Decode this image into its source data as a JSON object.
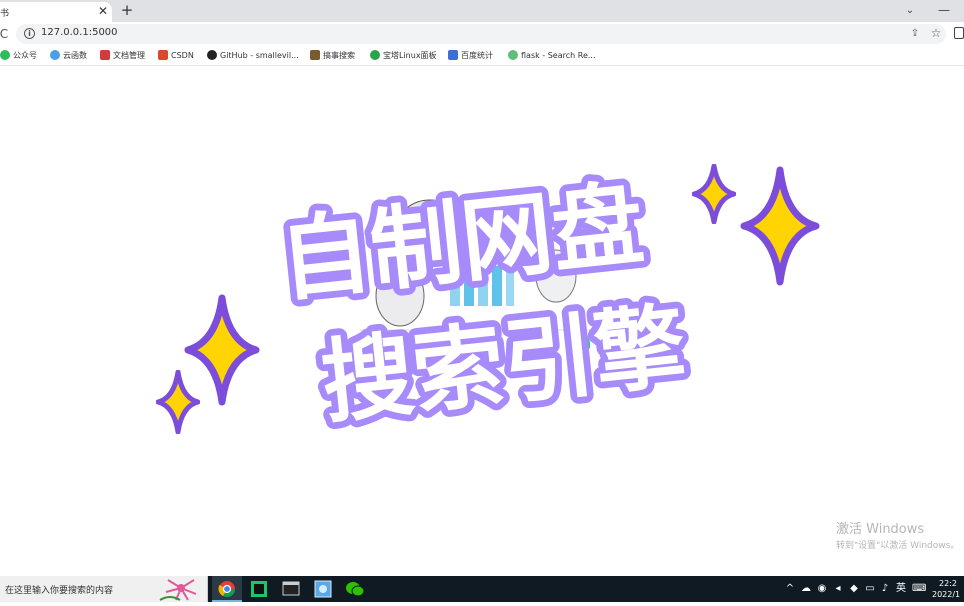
{
  "browser": {
    "tab": {
      "title": "书",
      "close": "✕"
    },
    "new_tab": "+",
    "tab_list": "⌄",
    "minimize": "—",
    "url": "127.0.0.1:5000",
    "reload_icon": "C"
  },
  "bookmarks": [
    {
      "label": "公众号",
      "icon": "wechat-icon",
      "color": "#2dbb5d"
    },
    {
      "label": "云函数",
      "icon": "cloud-icon",
      "color": "#4aa0e6"
    },
    {
      "label": "文档管理",
      "icon": "doc-icon",
      "color": "#d33b3b"
    },
    {
      "label": "CSDN",
      "icon": "csdn-icon",
      "color": "#d94a2b"
    },
    {
      "label": "GitHub - smallevil...",
      "icon": "github-icon",
      "color": "#222222"
    },
    {
      "label": "搞事搜索",
      "icon": "search-book-icon",
      "color": "#7a5a2f"
    },
    {
      "label": "宝塔Linux面板",
      "icon": "baota-icon",
      "color": "#2aa34a"
    },
    {
      "label": "百度统计",
      "icon": "baidu-icon",
      "color": "#3b6fd8"
    },
    {
      "label": "flask - Search Re...",
      "icon": "flask-icon",
      "color": "#5fbf7a"
    }
  ],
  "overlay": {
    "line1": "自制网盘",
    "line2": "搜索引擎",
    "text_color": "#ffffff",
    "outline_color": "#8b5cf6",
    "star_color": "#ffd400",
    "star_outline": "#7c4ddb"
  },
  "activation": {
    "title": "激活 Windows",
    "subtitle": "转到\"设置\"以激活 Windows。"
  },
  "taskbar": {
    "search_placeholder": "在这里输入你要搜索的内容",
    "tray": {
      "chevron": "^",
      "lang": "英",
      "time": "22:2",
      "date": "2022/1"
    }
  }
}
